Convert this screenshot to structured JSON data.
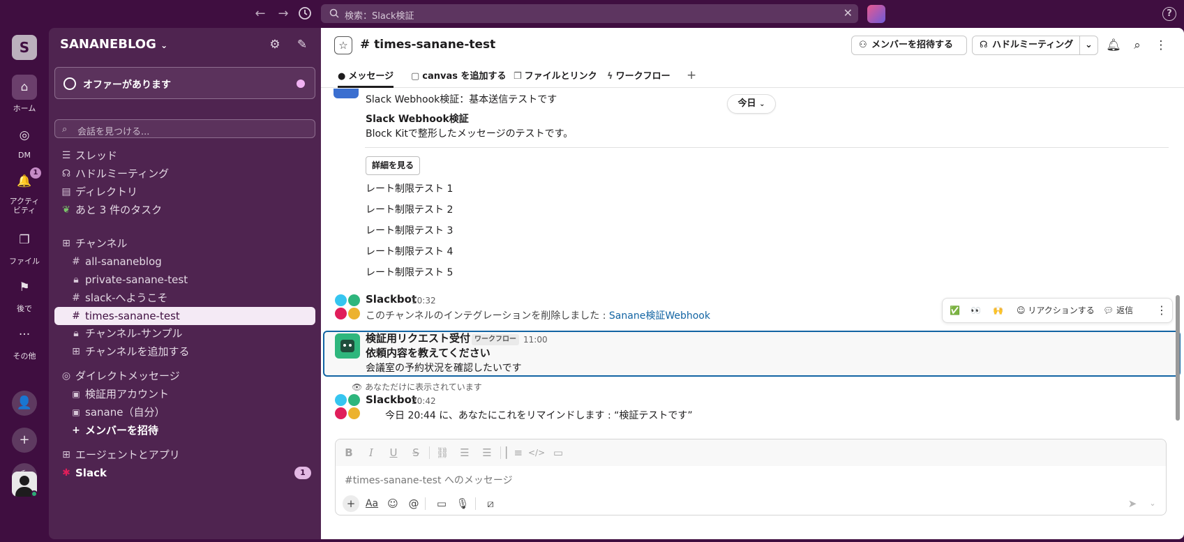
{
  "topbar": {
    "search_placeholder": "検索：Slack検証",
    "back_icon": "arrow-left-icon",
    "forward_icon": "arrow-right-icon",
    "history_icon": "clock-icon",
    "help_label": "?"
  },
  "rail": {
    "workspace_initial": "S",
    "items": [
      {
        "label": "ホーム",
        "icon": "home-icon"
      },
      {
        "label": "DM",
        "icon": "dm-icon"
      },
      {
        "label": "アクティビティ",
        "icon": "bell-icon",
        "badge": "1"
      },
      {
        "label": "ファイル",
        "icon": "files-icon"
      },
      {
        "label": "後で",
        "icon": "bookmark-icon"
      },
      {
        "label": "その他",
        "icon": "more-icon"
      }
    ]
  },
  "sidebar": {
    "workspace_name": "SANANEBLOG",
    "offer": "オファーがあります",
    "find_placeholder": "会話を見つける...",
    "top_items": [
      {
        "label": "スレッド",
        "icon": "threads-icon"
      },
      {
        "label": "ハドルミーティング",
        "icon": "headphones-icon"
      },
      {
        "label": "ディレクトリ",
        "icon": "directory-icon"
      },
      {
        "label": "あと 3 件のタスク",
        "icon": "sprout-icon"
      }
    ],
    "channels_header": "チャンネル",
    "channels": [
      {
        "label": "all-sananeblog",
        "icon": "#"
      },
      {
        "label": "private-sanane-test",
        "icon": "lock"
      },
      {
        "label": "slack-へようこそ",
        "icon": "#"
      },
      {
        "label": "times-sanane-test",
        "icon": "#",
        "active": true
      },
      {
        "label": "チャンネル-サンプル",
        "icon": "lock"
      },
      {
        "label": "チャンネルを追加する",
        "icon": "+"
      }
    ],
    "dm_header": "ダイレクトメッセージ",
    "dms": [
      {
        "label": "検証用アカウント"
      },
      {
        "label": "sanane（自分）"
      },
      {
        "label": "メンバーを招待"
      }
    ],
    "apps_header": "エージェントとアプリ",
    "apps": [
      {
        "label": "Slack",
        "badge": "1"
      }
    ]
  },
  "channel": {
    "name": "times-sanane-test",
    "invite_label": "メンバーを招待する",
    "huddle_label": "ハドルミーティング",
    "tabs": [
      "メッセージ",
      "canvas を追加する",
      "ファイルとリンク",
      "ワークフロー"
    ]
  },
  "messages": {
    "webhook_line": "Slack Webhook検証：基本送信テストです",
    "date_pill": "今日",
    "block_title": "Slack Webhook検証",
    "block_body": "Block Kitで整形したメッセージのテストです。",
    "detail_button": "詳細を見る",
    "rate_tests": [
      "レート制限テスト 1",
      "レート制限テスト 2",
      "レート制限テスト 3",
      "レート制限テスト 4",
      "レート制限テスト 5"
    ],
    "slackbot1": {
      "name": "Slackbot",
      "time": "10:32",
      "text": "このチャンネルのインテグレーションを削除しました : ",
      "link": "Sanane検証Webhook"
    },
    "workflow": {
      "name": "検証用リクエスト受付",
      "tag": "ワークフロー",
      "time": "11:00",
      "title": "依頼内容を教えてください",
      "body": "会議室の予約状況を確認したいです"
    },
    "only_you": "あなただけに表示されています",
    "slackbot2": {
      "name": "Slackbot",
      "time": "20:42",
      "text": "今日 20:44  に、あなたにこれをリマインドします : “検証テストです”"
    },
    "actions": {
      "react1": "✅",
      "react2": "👀",
      "react3": "🙌",
      "reaction_label": "リアクションする",
      "reply_label": "返信"
    }
  },
  "composer": {
    "placeholder": "#times-sanane-test へのメッセージ"
  }
}
